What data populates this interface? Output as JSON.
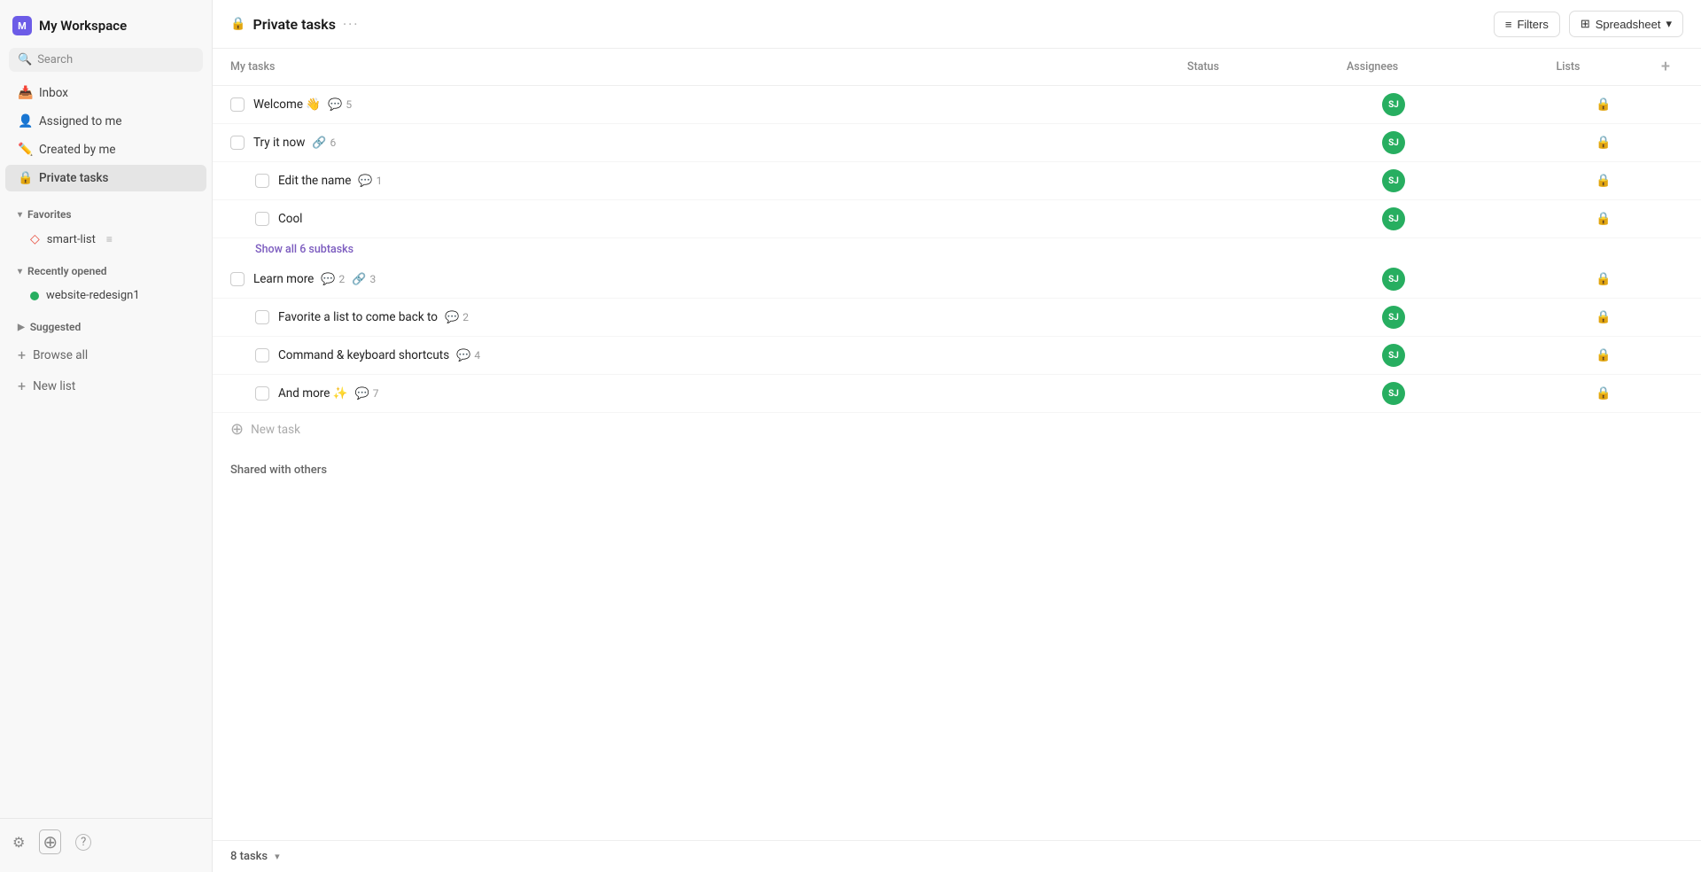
{
  "sidebar": {
    "workspace_label": "My Workspace",
    "workspace_initial": "M",
    "search_placeholder": "Search",
    "nav_items": [
      {
        "id": "inbox",
        "label": "Inbox",
        "icon": "📥"
      },
      {
        "id": "assigned",
        "label": "Assigned to me",
        "icon": "👤"
      },
      {
        "id": "created",
        "label": "Created by me",
        "icon": "✏️"
      },
      {
        "id": "private",
        "label": "Private tasks",
        "icon": "🔒",
        "active": true
      }
    ],
    "favorites_label": "Favorites",
    "favorites_items": [
      {
        "id": "smart-list",
        "label": "smart-list",
        "icon": "◇",
        "badge": "≡"
      }
    ],
    "recently_opened_label": "Recently opened",
    "recently_opened_items": [
      {
        "id": "website-redesign1",
        "label": "website-redesign1",
        "dot_color": "green"
      }
    ],
    "suggested_label": "Suggested",
    "browse_all_label": "Browse all",
    "new_list_label": "New list"
  },
  "topbar": {
    "title": "Private tasks",
    "filters_label": "Filters",
    "spreadsheet_label": "Spreadsheet"
  },
  "table": {
    "col_task": "My tasks",
    "col_status": "Status",
    "col_assignees": "Assignees",
    "col_lists": "Lists"
  },
  "tasks": [
    {
      "id": "welcome",
      "name": "Welcome 👋",
      "comment_count": 5,
      "link_count": null,
      "assignee": "SJ",
      "subtasks": []
    },
    {
      "id": "try-it-now",
      "name": "Try it now",
      "comment_count": null,
      "link_count": 6,
      "assignee": "SJ",
      "subtasks": [
        {
          "id": "edit-name",
          "name": "Edit the name",
          "comment_count": 1,
          "assignee": "SJ"
        },
        {
          "id": "cool",
          "name": "Cool",
          "comment_count": null,
          "assignee": "SJ"
        }
      ],
      "show_subtasks_label": "Show all 6 subtasks"
    },
    {
      "id": "learn-more",
      "name": "Learn more",
      "comment_count": 2,
      "link_count": 3,
      "assignee": "SJ",
      "subtasks": [
        {
          "id": "favorite-list",
          "name": "Favorite a list to come back to",
          "comment_count": 2,
          "assignee": "SJ"
        },
        {
          "id": "keyboard-shortcuts",
          "name": "Command & keyboard shortcuts",
          "comment_count": 4,
          "assignee": "SJ"
        },
        {
          "id": "and-more",
          "name": "And more ✨",
          "comment_count": 7,
          "assignee": "SJ"
        }
      ]
    }
  ],
  "new_task_label": "New task",
  "shared_section_label": "Shared with others",
  "bottom_bar": {
    "tasks_count": "8 tasks"
  }
}
